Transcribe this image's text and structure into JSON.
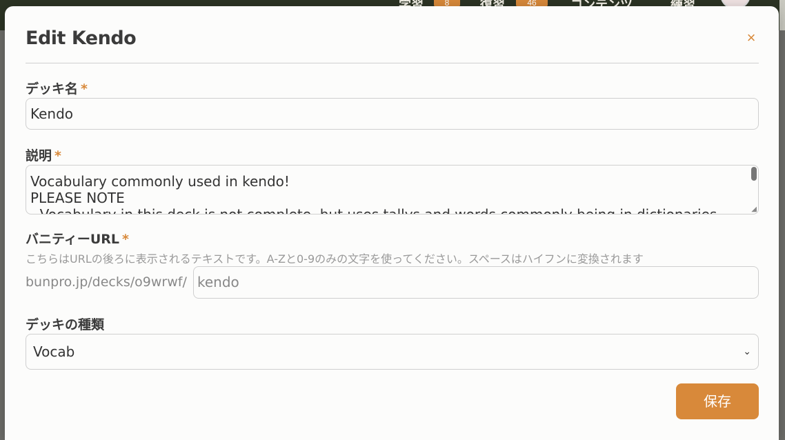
{
  "background": {
    "nav": [
      {
        "label": "学習",
        "badge": "8"
      },
      {
        "label": "復習",
        "badge": "46"
      },
      {
        "label": "コンテンツ"
      },
      {
        "label": "練習"
      }
    ],
    "avatar_icon": "avatar"
  },
  "modal": {
    "title": "Edit Kendo",
    "close_icon": "×",
    "required_mark": "*",
    "deck_name": {
      "label": "デッキ名",
      "value": "Kendo"
    },
    "description": {
      "label": "説明",
      "lines": [
        "Vocabulary commonly used in kendo!",
        "PLEASE NOTE",
        "- Vocabulary in this deck is not complete, but uses tallys and words commonly being in dictionaries"
      ]
    },
    "vanity_url": {
      "label": "バニティーURL",
      "hint": "こちらはURLの後ろに表示されるテキストです。A-Zと0-9のみの文字を使ってください。スペースはハイフンに変換されます",
      "prefix": "bunpro.jp/decks/o9wrwf/",
      "value": "kendo"
    },
    "deck_type": {
      "label": "デッキの種類",
      "value": "Vocab",
      "chevron": "⌄"
    },
    "save_label": "保存"
  },
  "colors": {
    "accent": "#d8893a",
    "topbar": "#2c3424"
  }
}
